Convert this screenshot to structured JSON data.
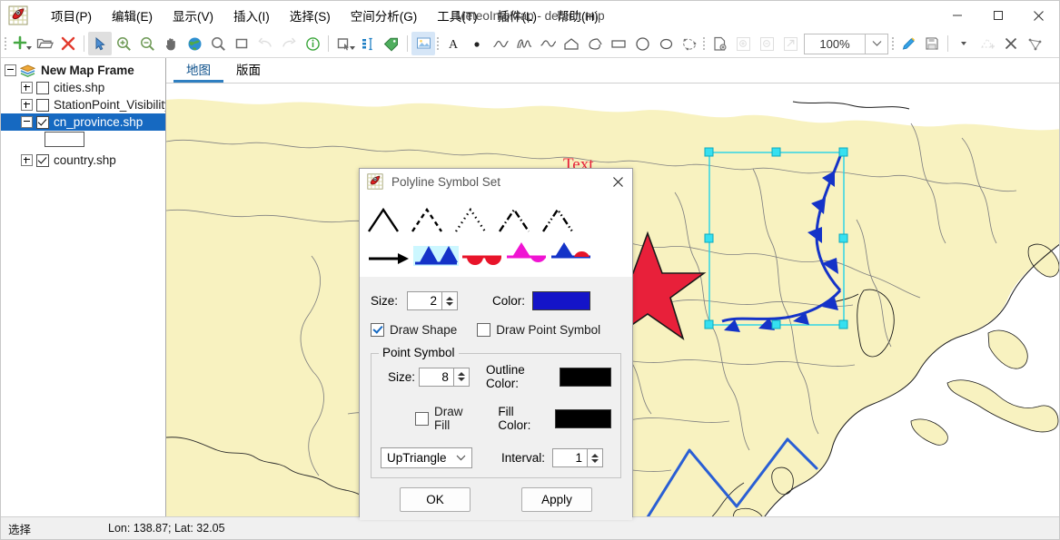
{
  "window": {
    "title": "MeteoInfoMap - default.mip",
    "app_icon": "meteoinfo-icon",
    "minimize": "—",
    "maximize": "☐",
    "close": "✕"
  },
  "menubar": {
    "items": [
      {
        "label": "项目(P)",
        "name": "menu-project"
      },
      {
        "label": "编辑(E)",
        "name": "menu-edit"
      },
      {
        "label": "显示(V)",
        "name": "menu-view"
      },
      {
        "label": "插入(I)",
        "name": "menu-insert"
      },
      {
        "label": "选择(S)",
        "name": "menu-select"
      },
      {
        "label": "空间分析(G)",
        "name": "menu-spatial-analysis"
      },
      {
        "label": "工具(T)",
        "name": "menu-tools"
      },
      {
        "label": "插件(L)",
        "name": "menu-plugins"
      },
      {
        "label": "帮助(H)",
        "name": "menu-help"
      }
    ]
  },
  "toolbar": {
    "zoom_level": "100%",
    "icons": [
      "new-layer-icon",
      "open-folder-icon",
      "delete-icon",
      "select-arrow-icon",
      "zoom-in-icon",
      "zoom-out-icon",
      "pan-hand-icon",
      "full-extent-globe-icon",
      "zoom-to-selection-icon",
      "select-rectangle-icon",
      "undo-icon",
      "redo-icon",
      "identify-icon",
      "select-feature-icon",
      "attribute-table-icon",
      "label-tag-icon",
      "layout-image-icon",
      "text-tool-icon",
      "point-tool-icon",
      "polyline-tool-icon",
      "freehand-tool-icon",
      "curve-tool-icon",
      "polygon-tool-icon",
      "freehand-polygon-icon",
      "rectangle-tool-icon",
      "circle-tool-icon",
      "ellipse-tool-icon",
      "curve-polygon-tool-icon",
      "page-setup-icon",
      "zoom-page-in-icon",
      "zoom-page-out-icon",
      "zoom-fit-page-icon",
      "edit-pencil-icon",
      "save-layer-icon",
      "dropdown-arrow-icon",
      "add-feature-icon",
      "delete-feature-icon",
      "edit-vertex-icon"
    ]
  },
  "sidebar": {
    "root": {
      "label": "New Map Frame",
      "icon": "layers-icon",
      "expander": "minus"
    },
    "items": [
      {
        "label": "cities.shp",
        "checked": false,
        "expander": "plus",
        "name": "layer-cities"
      },
      {
        "label": "StationPoint_Visibility_",
        "checked": false,
        "expander": "plus",
        "name": "layer-stationpoint-visibility"
      },
      {
        "label": "cn_province.shp",
        "checked": true,
        "expander": "minus",
        "selected": true,
        "name": "layer-cn-province"
      },
      {
        "label": "country.shp",
        "checked": true,
        "expander": "plus",
        "name": "layer-country"
      }
    ],
    "legend_swatch": "polygon-swatch"
  },
  "tabs": [
    {
      "label": "地图",
      "active": true,
      "name": "tab-map"
    },
    {
      "label": "版面",
      "active": false,
      "name": "tab-layout"
    }
  ],
  "map": {
    "text_annotation": "Text",
    "land_color": "#f8f2c0",
    "sea_color": "#ffffff",
    "border_color": "#7a7a7a",
    "coast_color": "#1a1a1a",
    "draw_color": "#1f4fd8",
    "star_color": "#e8203a",
    "selection_color": "#22d3e8"
  },
  "dialog": {
    "title": "Polyline Symbol Set",
    "icon": "meteoinfo-icon",
    "close": "✕",
    "size_label": "Size:",
    "size_value": "2",
    "color_label": "Color:",
    "color_value": "#1414c8",
    "draw_shape_label": "Draw Shape",
    "draw_shape_checked": true,
    "draw_point_symbol_label": "Draw Point Symbol",
    "draw_point_symbol_checked": false,
    "point_symbol": {
      "group_label": "Point Symbol",
      "size_label": "Size:",
      "size_value": "8",
      "outline_color_label": "Outline Color:",
      "outline_color_value": "#000000",
      "draw_fill_label": "Draw Fill",
      "draw_fill_checked": false,
      "fill_color_label": "Fill Color:",
      "fill_color_value": "#000000",
      "shape_value": "UpTriangle",
      "interval_label": "Interval:",
      "interval_value": "1"
    },
    "ok_label": "OK",
    "apply_label": "Apply"
  },
  "status": {
    "mode": "选择",
    "coords": "Lon: 138.87; Lat: 32.05"
  }
}
